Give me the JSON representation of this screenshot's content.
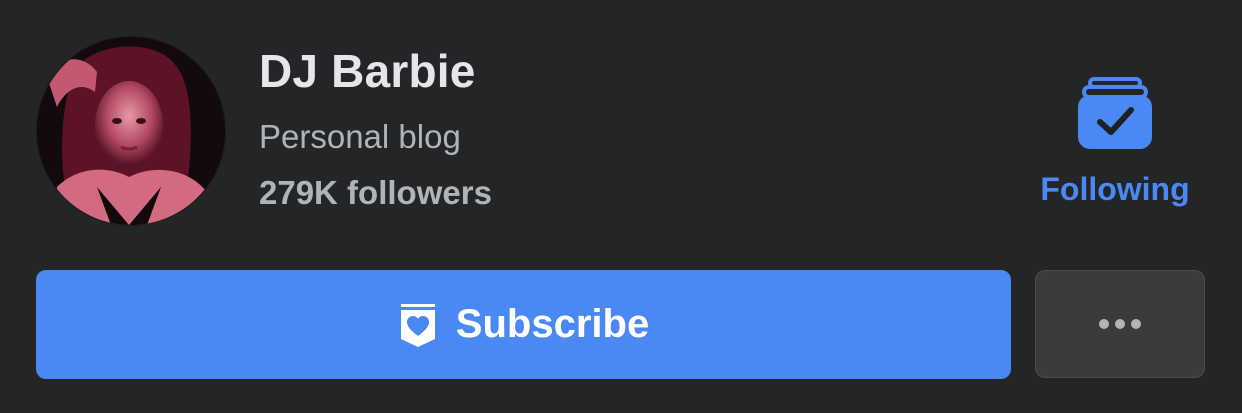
{
  "profile": {
    "name": "DJ Barbie",
    "category": "Personal blog",
    "followers": "279K followers",
    "avatar_icon": "profile-photo"
  },
  "following": {
    "label": "Following",
    "icon": "following-check-icon",
    "color": "#4a89f3"
  },
  "actions": {
    "subscribe_label": "Subscribe",
    "subscribe_icon": "heart-badge-icon",
    "more_icon": "more-dots-icon",
    "primary_color": "#4a89f3"
  },
  "theme": {
    "background": "#242526",
    "text_primary": "#e4e6eb",
    "text_secondary": "#b0b3b8"
  }
}
